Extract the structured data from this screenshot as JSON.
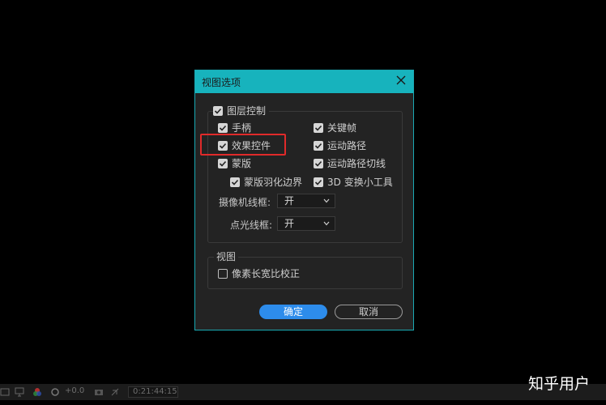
{
  "dialog": {
    "title": "视图选项",
    "layer_controls": {
      "label": "图层控制",
      "checked": true,
      "left_items": [
        {
          "label": "手柄",
          "checked": true
        },
        {
          "label": "效果控件",
          "checked": true
        },
        {
          "label": "蒙版",
          "checked": true
        },
        {
          "label": "蒙版羽化边界",
          "checked": true
        }
      ],
      "right_items": [
        {
          "label": "关键帧",
          "checked": true
        },
        {
          "label": "运动路径",
          "checked": true
        },
        {
          "label": "运动路径切线",
          "checked": true
        },
        {
          "label": "3D 变换小工具",
          "checked": true
        }
      ],
      "camera_wireframe": {
        "label": "摄像机线框:",
        "value": "开"
      },
      "spotlight_wireframe": {
        "label": "点光线框:",
        "value": "开"
      }
    },
    "view": {
      "label": "视图",
      "pixel_aspect": {
        "label": "像素长宽比校正",
        "checked": false
      }
    },
    "ok_label": "确定",
    "cancel_label": "取消"
  },
  "bottom_bar": {
    "exposure": "+0.0",
    "timecode": "0:21:44:15"
  },
  "watermark": "知乎用户",
  "colors": {
    "title_bar": "#17b3bd",
    "highlight": "#e02a2a",
    "ok_button": "#2d8ceb"
  }
}
